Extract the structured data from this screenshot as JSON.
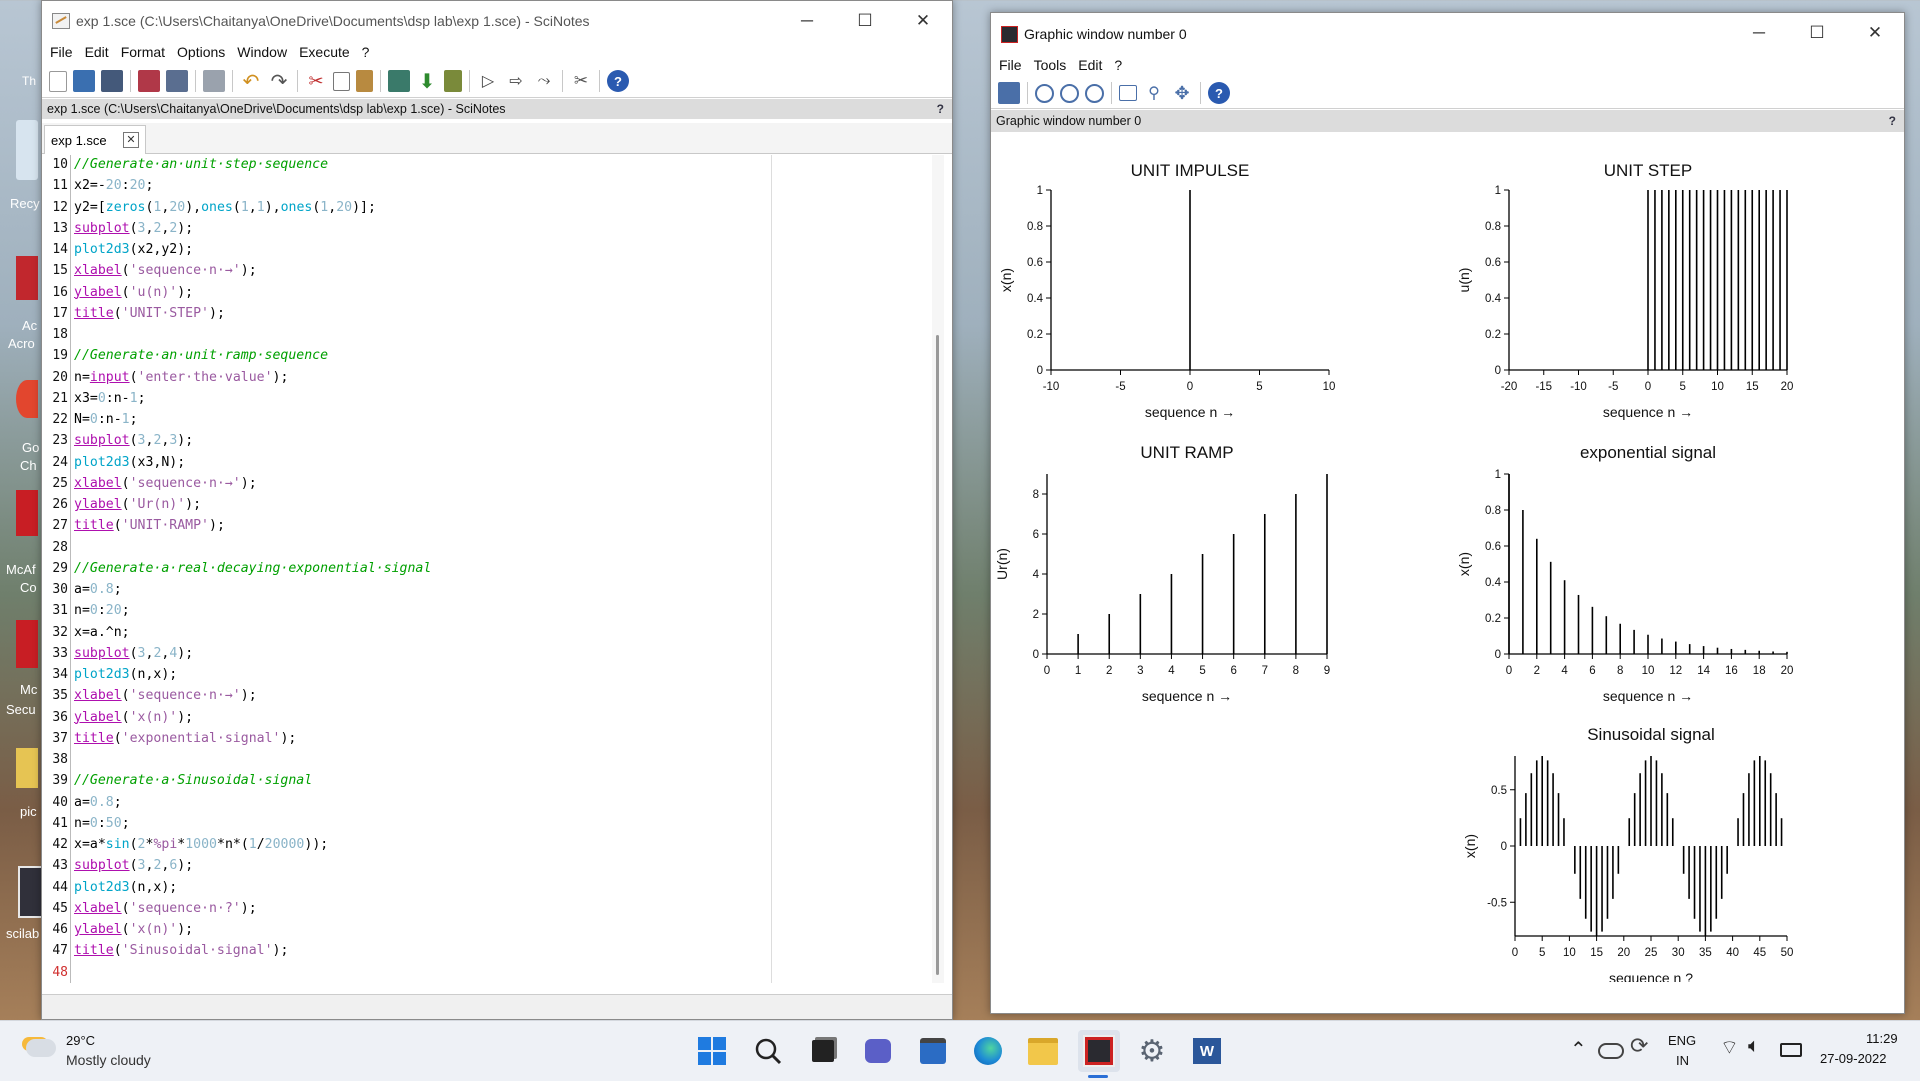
{
  "desktop": {
    "icons": [
      "Th",
      "Recy",
      "Ac",
      "Acro",
      "Go",
      "Ch",
      "McAf",
      "Co",
      "Mc",
      "Secu",
      "pic",
      "scilab"
    ]
  },
  "scinotes": {
    "title": "exp 1.sce (C:\\Users\\Chaitanya\\OneDrive\\Documents\\dsp lab\\exp 1.sce) - SciNotes",
    "menu": [
      "File",
      "Edit",
      "Format",
      "Options",
      "Window",
      "Execute",
      "?"
    ],
    "path_bar": "exp 1.sce (C:\\Users\\Chaitanya\\OneDrive\\Documents\\dsp lab\\exp 1.sce) - SciNotes",
    "help": "?",
    "tab": "exp 1.sce",
    "line_numbers": [
      "10",
      "11",
      "12",
      "13",
      "14",
      "15",
      "16",
      "17",
      "18",
      "19",
      "20",
      "21",
      "22",
      "23",
      "24",
      "25",
      "26",
      "27",
      "28",
      "29",
      "30",
      "31",
      "32",
      "33",
      "34",
      "35",
      "36",
      "37",
      "38",
      "39",
      "40",
      "41",
      "42",
      "43",
      "44",
      "45",
      "46",
      "47",
      "48"
    ],
    "lines": [
      "//Generate an unit step sequence",
      "x2=-20:20;",
      "y2=[zeros(1,20),ones(1,1),ones(1,20)];",
      "subplot(3,2,2);",
      "plot2d3(x2,y2);",
      "xlabel('sequence n →');",
      "ylabel('u(n)');",
      "title('UNIT STEP');",
      "",
      "//Generate an unit ramp sequence",
      "n=input('enter the value');",
      "x3=0:n-1;",
      "N=0:n-1;",
      "subplot(3,2,3);",
      "plot2d3(x3,N);",
      "xlabel('sequence n →');",
      "ylabel('Ur(n)');",
      "title('UNIT RAMP');",
      "",
      "//Generate a real decaying exponential signal",
      "a=0.8;",
      "n=0:20;",
      "x=a.^n;",
      "subplot(3,2,4);",
      "plot2d3(n,x);",
      "xlabel('sequence n →');",
      "ylabel('x(n)');",
      "title('exponential signal');",
      "",
      "//Generate a Sinusoidal signal",
      "a=0.8;",
      "n=0:50;",
      "x=a*sin(2*%pi*1000*n*(1/20000));",
      "subplot(3,2,6);",
      "plot2d3(n,x);",
      "xlabel('sequence n ?');",
      "ylabel('x(n)');",
      "title('Sinusoidal signal');",
      ""
    ]
  },
  "graphic": {
    "title": "Graphic window number 0",
    "menu": [
      "File",
      "Tools",
      "Edit",
      "?"
    ],
    "info_bar": "Graphic window number 0",
    "help": "?"
  },
  "chart_data": [
    {
      "type": "stem",
      "title": "UNIT IMPULSE",
      "xlabel": "sequence n →",
      "ylabel": "x(n)",
      "xlim": [
        -10,
        10
      ],
      "ylim": [
        0,
        1
      ],
      "xticks": [
        "-10",
        "-5",
        "0",
        "5",
        "10"
      ],
      "yticks": [
        "0",
        "0.2",
        "0.4",
        "0.6",
        "0.8",
        "1"
      ],
      "x": [
        -10,
        -9,
        -8,
        -7,
        -6,
        -5,
        -4,
        -3,
        -2,
        -1,
        0,
        1,
        2,
        3,
        4,
        5,
        6,
        7,
        8,
        9,
        10
      ],
      "y": [
        0,
        0,
        0,
        0,
        0,
        0,
        0,
        0,
        0,
        0,
        1,
        0,
        0,
        0,
        0,
        0,
        0,
        0,
        0,
        0,
        0
      ]
    },
    {
      "type": "stem",
      "title": "UNIT STEP",
      "xlabel": "sequence n →",
      "ylabel": "u(n)",
      "xlim": [
        -20,
        20
      ],
      "ylim": [
        0,
        1
      ],
      "xticks": [
        "-20",
        "-15",
        "-10",
        "-5",
        "0",
        "5",
        "10",
        "15",
        "20"
      ],
      "yticks": [
        "0",
        "0.2",
        "0.4",
        "0.6",
        "0.8",
        "1"
      ],
      "x": [
        0,
        1,
        2,
        3,
        4,
        5,
        6,
        7,
        8,
        9,
        10,
        11,
        12,
        13,
        14,
        15,
        16,
        17,
        18,
        19,
        20
      ],
      "y": [
        1,
        1,
        1,
        1,
        1,
        1,
        1,
        1,
        1,
        1,
        1,
        1,
        1,
        1,
        1,
        1,
        1,
        1,
        1,
        1,
        1
      ]
    },
    {
      "type": "stem",
      "title": "UNIT RAMP",
      "xlabel": "sequence n →",
      "ylabel": "Ur(n)",
      "xlim": [
        0,
        9
      ],
      "ylim": [
        0,
        9
      ],
      "xticks": [
        "0",
        "1",
        "2",
        "3",
        "4",
        "5",
        "6",
        "7",
        "8",
        "9"
      ],
      "yticks": [
        "0",
        "2",
        "4",
        "6",
        "8"
      ],
      "x": [
        0,
        1,
        2,
        3,
        4,
        5,
        6,
        7,
        8,
        9
      ],
      "y": [
        0,
        1,
        2,
        3,
        4,
        5,
        6,
        7,
        8,
        9
      ]
    },
    {
      "type": "stem",
      "title": "exponential signal",
      "xlabel": "sequence n →",
      "ylabel": "x(n)",
      "xlim": [
        0,
        20
      ],
      "ylim": [
        0,
        1
      ],
      "xticks": [
        "0",
        "2",
        "4",
        "6",
        "8",
        "10",
        "12",
        "14",
        "16",
        "18",
        "20"
      ],
      "yticks": [
        "0",
        "0.2",
        "0.4",
        "0.6",
        "0.8",
        "1"
      ],
      "x": [
        0,
        1,
        2,
        3,
        4,
        5,
        6,
        7,
        8,
        9,
        10,
        11,
        12,
        13,
        14,
        15,
        16,
        17,
        18,
        19,
        20
      ],
      "y": [
        1,
        0.8,
        0.64,
        0.512,
        0.41,
        0.328,
        0.262,
        0.21,
        0.168,
        0.134,
        0.107,
        0.086,
        0.069,
        0.055,
        0.044,
        0.035,
        0.028,
        0.023,
        0.018,
        0.014,
        0.012
      ]
    },
    {
      "type": "stem",
      "title": "Sinusoidal signal",
      "xlabel": "sequence n ?",
      "ylabel": "x(n)",
      "xlim": [
        0,
        50
      ],
      "ylim": [
        -0.8,
        0.8
      ],
      "xticks": [
        "0",
        "5",
        "10",
        "15",
        "20",
        "25",
        "30",
        "35",
        "40",
        "45",
        "50"
      ],
      "yticks": [
        "-0.5",
        "0",
        "0.5"
      ],
      "x": [
        0,
        1,
        2,
        3,
        4,
        5,
        6,
        7,
        8,
        9,
        10,
        11,
        12,
        13,
        14,
        15,
        16,
        17,
        18,
        19,
        20,
        21,
        22,
        23,
        24,
        25,
        26,
        27,
        28,
        29,
        30,
        31,
        32,
        33,
        34,
        35,
        36,
        37,
        38,
        39,
        40,
        41,
        42,
        43,
        44,
        45,
        46,
        47,
        48,
        49,
        50
      ],
      "y": [
        0,
        0.247,
        0.47,
        0.647,
        0.761,
        0.8,
        0.761,
        0.647,
        0.47,
        0.247,
        0,
        -0.247,
        -0.47,
        -0.647,
        -0.761,
        -0.8,
        -0.761,
        -0.647,
        -0.47,
        -0.247,
        0,
        0.247,
        0.47,
        0.647,
        0.761,
        0.8,
        0.761,
        0.647,
        0.47,
        0.247,
        0,
        -0.247,
        -0.47,
        -0.647,
        -0.761,
        -0.8,
        -0.761,
        -0.647,
        -0.47,
        -0.247,
        0,
        0.247,
        0.47,
        0.647,
        0.761,
        0.8,
        0.761,
        0.647,
        0.47,
        0.247,
        0
      ]
    }
  ],
  "taskbar": {
    "weather_temp": "29°C",
    "weather_desc": "Mostly cloudy",
    "lang1": "ENG",
    "lang2": "IN",
    "time": "11:29",
    "date": "27-09-2022"
  }
}
